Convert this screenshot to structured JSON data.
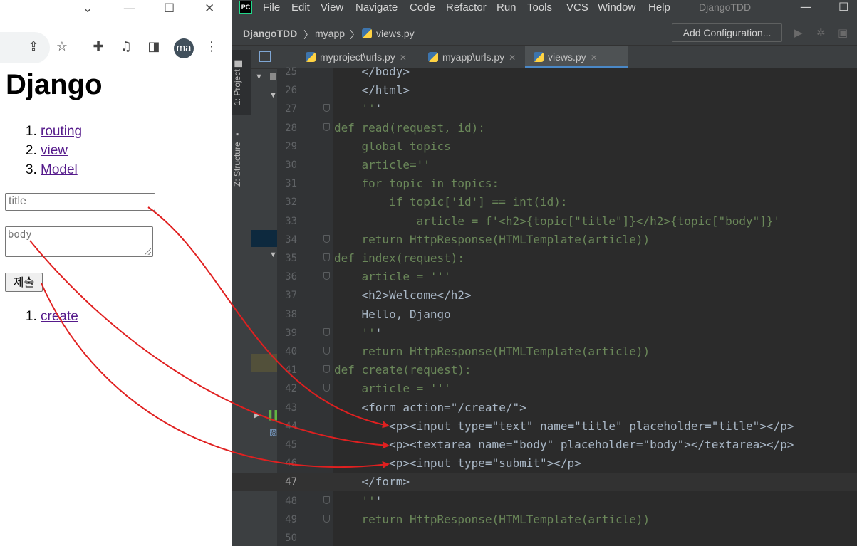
{
  "browser": {
    "toolbar_icons": [
      "share-icon",
      "star-icon",
      "extensions-icon",
      "media-icon",
      "side-panel-icon",
      "menu-icon"
    ],
    "avatar_text": "ma",
    "page": {
      "title": "Django",
      "topics": [
        "routing",
        "view",
        "Model"
      ],
      "title_placeholder": "title",
      "body_placeholder": "body",
      "submit_label": "제출",
      "create_link": "create"
    }
  },
  "ide": {
    "menu": [
      "File",
      "Edit",
      "View",
      "Navigate",
      "Code",
      "Refactor",
      "Run",
      "Tools",
      "VCS",
      "Window",
      "Help"
    ],
    "project_title": "DjangoTDD",
    "breadcrumb": [
      "DjangoTDD",
      "myapp",
      "views.py"
    ],
    "add_configuration": "Add Configuration...",
    "side_tabs": [
      "1: Project",
      "Z: Structure"
    ],
    "tabs": [
      {
        "label": "myproject\\urls.py",
        "active": false
      },
      {
        "label": "myapp\\urls.py",
        "active": false
      },
      {
        "label": "views.py",
        "active": true
      }
    ],
    "current_line": 47,
    "code_lines": [
      {
        "n": 25,
        "text": "    </body>"
      },
      {
        "n": 26,
        "text": "    </html>"
      },
      {
        "n": 27,
        "text": "    '''"
      },
      {
        "n": 28,
        "text": "def read(request, id):"
      },
      {
        "n": 29,
        "text": "    global topics"
      },
      {
        "n": 30,
        "text": "    article=''"
      },
      {
        "n": 31,
        "text": "    for topic in topics:"
      },
      {
        "n": 32,
        "text": "        if topic['id'] == int(id):"
      },
      {
        "n": 33,
        "text": "            article = f'<h2>{topic[\"title\"]}</h2>{topic[\"body\"]}'"
      },
      {
        "n": 34,
        "text": "    return HttpResponse(HTMLTemplate(article))"
      },
      {
        "n": 35,
        "text": "def index(request):"
      },
      {
        "n": 36,
        "text": "    article = '''"
      },
      {
        "n": 37,
        "text": "    <h2>Welcome</h2>"
      },
      {
        "n": 38,
        "text": "    Hello, Django"
      },
      {
        "n": 39,
        "text": "    '''"
      },
      {
        "n": 40,
        "text": "    return HttpResponse(HTMLTemplate(article))"
      },
      {
        "n": 41,
        "text": "def create(request):"
      },
      {
        "n": 42,
        "text": "    article = '''"
      },
      {
        "n": 43,
        "text": "    <form action=\"/create/\">"
      },
      {
        "n": 44,
        "text": "        <p><input type=\"text\" name=\"title\" placeholder=\"title\"></p>"
      },
      {
        "n": 45,
        "text": "        <p><textarea name=\"body\" placeholder=\"body\"></textarea></p>"
      },
      {
        "n": 46,
        "text": "        <p><input type=\"submit\"></p>"
      },
      {
        "n": 47,
        "text": "    </form>"
      },
      {
        "n": 48,
        "text": "    '''"
      },
      {
        "n": 49,
        "text": "    return HttpResponse(HTMLTemplate(article))"
      },
      {
        "n": 50,
        "text": ""
      }
    ]
  },
  "annotation_color": "#e02020"
}
